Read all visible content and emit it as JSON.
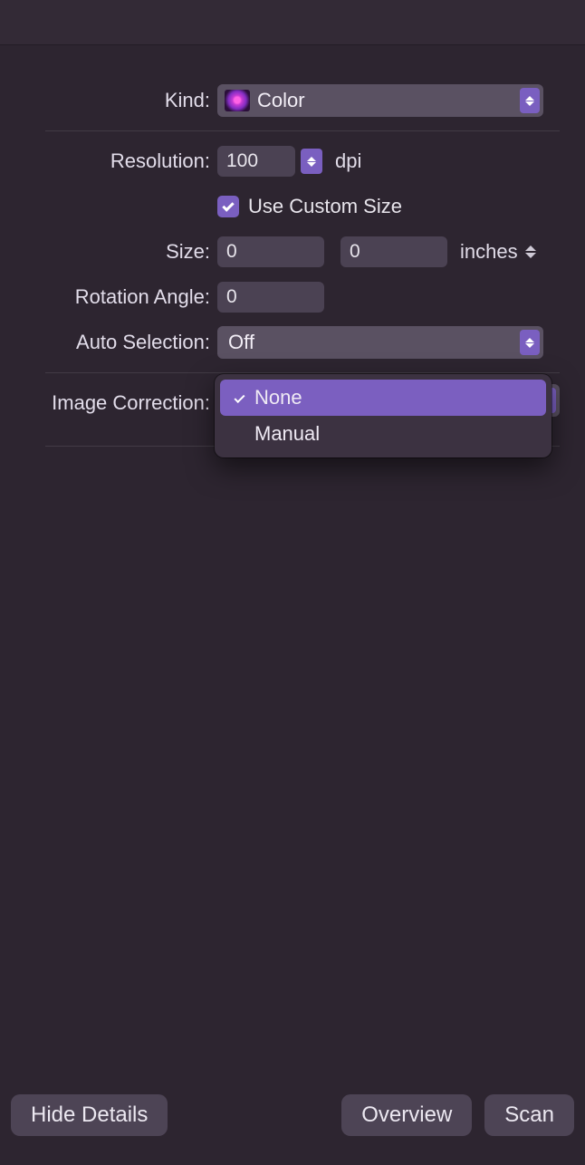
{
  "labels": {
    "kind": "Kind:",
    "resolution": "Resolution:",
    "size": "Size:",
    "rotation": "Rotation Angle:",
    "auto_selection": "Auto Selection:",
    "image_correction": "Image Correction:"
  },
  "values": {
    "kind": "Color",
    "resolution": "100",
    "resolution_unit": "dpi",
    "use_custom_size_checked": true,
    "use_custom_size_label": "Use Custom Size",
    "size_w": "0",
    "size_h": "0",
    "size_unit": "inches",
    "rotation": "0",
    "auto_selection": "Off"
  },
  "image_correction_popup": {
    "options": [
      "None",
      "Manual"
    ],
    "selected": "None"
  },
  "buttons": {
    "hide_details": "Hide Details",
    "overview": "Overview",
    "scan": "Scan"
  }
}
